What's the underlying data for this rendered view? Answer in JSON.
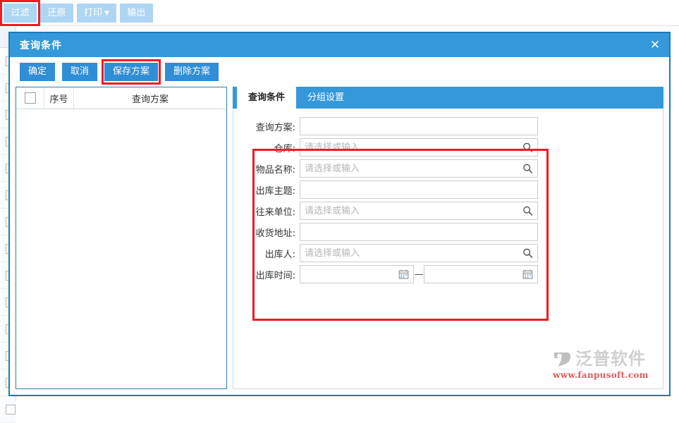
{
  "toolbar": {
    "buttons": [
      {
        "label": "过滤",
        "icon": "filter-icon",
        "highlighted": true,
        "dropdown": false
      },
      {
        "label": "还原",
        "icon": "restore-icon",
        "highlighted": false,
        "dropdown": false
      },
      {
        "label": "打印",
        "icon": "print-icon",
        "highlighted": false,
        "dropdown": true,
        "caret": "▼"
      },
      {
        "label": "输出",
        "icon": "export-icon",
        "highlighted": false,
        "dropdown": false
      }
    ]
  },
  "dialog": {
    "title": "查询条件",
    "close_label": "✕",
    "buttons": [
      {
        "label": "确定",
        "name": "confirm-button",
        "highlighted": false
      },
      {
        "label": "取消",
        "name": "cancel-button",
        "highlighted": false
      },
      {
        "label": "保存方案",
        "name": "save-scheme-button",
        "highlighted": true
      },
      {
        "label": "删除方案",
        "name": "delete-scheme-button",
        "highlighted": false
      }
    ],
    "scheme_table": {
      "headers": [
        "",
        "序号",
        "查询方案"
      ],
      "rows": []
    },
    "tabs": [
      {
        "label": "查询条件",
        "active": true
      },
      {
        "label": "分组设置",
        "active": false
      }
    ],
    "form": {
      "fields": [
        {
          "label": "查询方案:",
          "name": "query-scheme-field",
          "value": "",
          "placeholder": "",
          "icon": ""
        },
        {
          "label": "仓库:",
          "name": "warehouse-field",
          "value": "",
          "placeholder": "请选择或输入",
          "icon": "search-icon"
        },
        {
          "label": "物品名称:",
          "name": "item-name-field",
          "value": "",
          "placeholder": "请选择或输入",
          "icon": "search-icon"
        },
        {
          "label": "出库主题:",
          "name": "outbound-subject-field",
          "value": "",
          "placeholder": "",
          "icon": ""
        },
        {
          "label": "往来单位:",
          "name": "counterparty-field",
          "value": "",
          "placeholder": "请选择或输入",
          "icon": "search-icon"
        },
        {
          "label": "收货地址:",
          "name": "delivery-address-field",
          "value": "",
          "placeholder": "",
          "icon": ""
        },
        {
          "label": "出库人:",
          "name": "outbound-person-field",
          "value": "",
          "placeholder": "请选择或输入",
          "icon": "search-icon"
        }
      ],
      "date_field": {
        "label": "出库时间:",
        "name": "outbound-time-range",
        "start_value": "",
        "start_placeholder": "",
        "end_value": "",
        "end_placeholder": "",
        "separator": "—",
        "icon": "calendar-icon"
      }
    }
  },
  "watermark": {
    "brand": "泛普软件",
    "url": "www.fanpusoft.com",
    "logo": "fanpu-logo-icon"
  },
  "colors": {
    "header_blue": "#3498db",
    "button_blue": "#2f8ed6",
    "toolbar_button_blue": "#aed5f2",
    "annotation_red": "#ee1c25",
    "dialog_border": "#1a7bbd"
  }
}
